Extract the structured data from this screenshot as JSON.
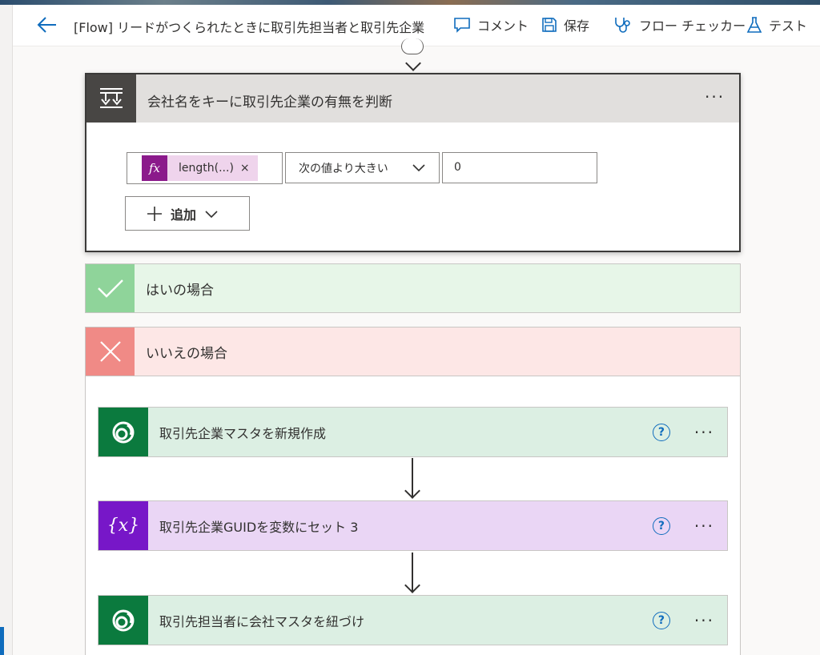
{
  "header": {
    "flow_title": "[Flow] リードがつくられたときに取引先担当者と取引先企業",
    "comment_label": "コメント",
    "save_label": "保存",
    "checker_label": "フロー チェッカー",
    "test_label": "テスト",
    "accent_color": "#0f6cbd"
  },
  "condition": {
    "title": "会社名をキーに取引先企業の有無を判断",
    "more_label": "···",
    "left_token_fx": "fx",
    "left_token_text": "length(...)",
    "left_token_remove": "×",
    "operator_value": "次の値より大きい",
    "right_value": "0",
    "add_label": "追加"
  },
  "branches": {
    "yes_label": "はいの場合",
    "no_label": "いいえの場合",
    "yes_color": "#8fd49a",
    "no_color": "#f08a86"
  },
  "actions": [
    {
      "label": "取引先企業マスタを新規作成",
      "icon": "dataverse-icon",
      "help": "?",
      "more": "···"
    },
    {
      "label": "取引先企業GUIDを変数にセット 3",
      "icon": "variable-icon",
      "icon_text": "{x}",
      "help": "?",
      "more": "···"
    },
    {
      "label": "取引先担当者に会社マスタを紐づけ",
      "icon": "dataverse-icon",
      "help": "?",
      "more": "···"
    }
  ]
}
